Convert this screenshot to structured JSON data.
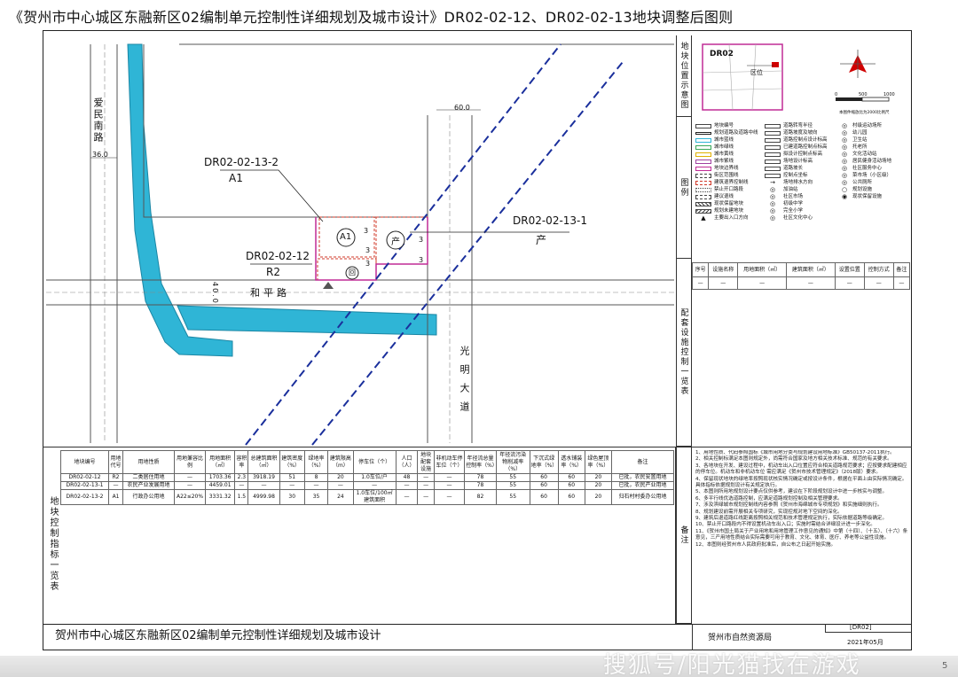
{
  "title": "《贺州市中心城区东融新区02编制单元控制性详细规划及城市设计》DR02-02-12、DR02-02-13地块调整后图则",
  "map": {
    "road_west_name": "爱民南路",
    "road_west_width": "36.0",
    "road_north_width": "60.0",
    "road_main_name": "和平路",
    "road_main_width": "40.0",
    "road_east_name": "光明大道",
    "parcel_a_code": "DR02-02-13-2",
    "parcel_a_use": "A1",
    "parcel_b_code": "DR02-02-12",
    "parcel_b_use": "R2",
    "parcel_c_code": "DR02-02-13-1",
    "parcel_c_use": "产",
    "circle_a1": "A1",
    "circle_chan": "产",
    "circle_wei": "回",
    "nums": [
      "3",
      "3",
      "3",
      "3",
      "3"
    ]
  },
  "location": {
    "header": "地块位置示意图",
    "unit_label": "DR02",
    "zone_label": "区位",
    "scale_ticks": [
      "0",
      "500",
      "1000"
    ],
    "scale_note": "本图件缩放比为2000比例尺"
  },
  "legend": {
    "header": "图例",
    "col1": [
      "地块编号",
      "规划道路及道路中线",
      "城市蓝线",
      "城市绿线",
      "城市黄线",
      "城市紫线",
      "地块边界线",
      "街区范围线",
      "建筑退界控制线",
      "禁止开口路段",
      "建议退线",
      "现状保留地块",
      "规划未建地块",
      "主要出入口方向"
    ],
    "col2": [
      "道路转弯半径",
      "道路坡度及坡向",
      "道路控制点设计标高",
      "已建道路控制点标高",
      "拟设计控制点标高",
      "场地设计标高",
      "道路坡长",
      "控制点坐标",
      "场地排水方向",
      "加油站",
      "社区市场",
      "初级中学",
      "完全小学",
      "社区文化中心"
    ],
    "col3": [
      "村级运动场所",
      "幼儿园",
      "卫生站",
      "托老所",
      "文化活动站",
      "居民健身活动场地",
      "社区服务中心",
      "菜市场（小区级）",
      "公共厕所",
      "规划设施",
      "现状保留设施"
    ]
  },
  "facility": {
    "header": "配套设施控制一览表",
    "columns": [
      "序号",
      "设施名称",
      "用地面积（㎡）",
      "建筑面积（㎡）",
      "设置位置",
      "控制方式",
      "备注"
    ],
    "row": [
      "—",
      "—",
      "—",
      "—",
      "—",
      "—",
      "—"
    ]
  },
  "indicator": {
    "header": "地块控制指标一览表",
    "columns": [
      "地块编号",
      "用地代号",
      "用地性质",
      "用地兼容比例",
      "用地面积（㎡）",
      "容积率",
      "总建筑面积（㎡）",
      "建筑密度（%）",
      "绿地率（%）",
      "建筑限高（m）",
      "停车位（个）",
      "配套设施",
      "人口（人）",
      "地块配套设施",
      "非机动车停车位（个）",
      "年径流总量控制率（%）",
      "年径流污染物削减率（%）",
      "下沉式绿地率（%）",
      "透水铺装率（%）",
      "绿色屋顶率（%）",
      "备注"
    ],
    "rows": [
      [
        "DR02-02-12",
        "R2",
        "二类居住用地",
        "—",
        "1703.36",
        "2.3",
        "3918.19",
        "51",
        "8",
        "20",
        "1.0车位/户",
        "48",
        "—",
        "—",
        "78",
        "55",
        "60",
        "60",
        "20",
        "已批，农民安置用地"
      ],
      [
        "DR02-02-13-1",
        "—",
        "农民产业发展用地",
        "—",
        "4459.01",
        "—",
        "—",
        "—",
        "—",
        "—",
        "—",
        "—",
        "—",
        "—",
        "78",
        "55",
        "60",
        "60",
        "20",
        "已批，农民产业用地"
      ],
      [
        "DR02-02-13-2",
        "A1",
        "行政办公用地",
        "A22≤20%",
        "3331.32",
        "1.5",
        "4999.98",
        "30",
        "35",
        "24",
        "1.0车位/100㎡建筑面积",
        "—",
        "—",
        "—",
        "82",
        "55",
        "60",
        "60",
        "20",
        "归石村村委办公用地"
      ]
    ]
  },
  "notes": {
    "header": "备注",
    "items": [
      "1、用地性质、代码参照国标《城市用地分类与规划建设用地标准》GB50137-2011执行。",
      "2、相关控制标满足本图则规定外，尚需符合国家及地方相关技术标准、规范的有关要求。",
      "3、各地块在开发、建设过程中，机动车出入口位置应符合相关道路规范要求；应按要求配建相应的停车位。机动车和非机动车位 需应满足《贺州市技术管理规定》（2018版）要求。",
      "4、保留现状地块的绿地率按照现状核实情况确定或按设计条件，根据在平面上由实际情况确定。具体指标依据规划设计有关规定执行。",
      "5、本图则所用地规划设计要点仅供参考，建议在下阶段规划设计中进一步核实与调整。",
      "6、多平行线优选道路控制，应满足道路规划控制及相关管理要求。",
      "7、涉及滨绿城市规划控制线内容参照《贺州市海绵城市专项规划》和实施细则执行。",
      "8、规划建设前需开展相关专项研究，实现控规对地下空间的深化。",
      "9、建筑后退道路红线距离按照相关规范和技术管理规定执行，实际依据道路等级确定。",
      "10、禁止开口路段内不得设置机动车出入口；实施时需结合详细设计进一步深化。",
      "11、《贺州市国土局关于产业用地和用地管理工作意见的通知》中第（十四）、（十五）、（十六）条意见，三产用地性质结合实际需要可用于教育、文化、体育、医疗、养老等公益性设施。",
      "12、本图则经贺州市人民政府批准后，自公布之日起开始实施。"
    ]
  },
  "footer": {
    "plan_name": "贺州市中心城区东融新区02编制单元控制性详细规划及城市设计",
    "code": "[DR02]",
    "authority": "贺州市自然资源局",
    "date": "2021年05月"
  },
  "watermark": "搜狐号/阳光猫找在游戏",
  "page_num": "5",
  "colors": {
    "water": "#2fb5d6",
    "road_line": "#555555",
    "dashed_route": "#1a2f9c",
    "parcel_boundary": "#c02c96",
    "parcel_dash": "#d0392a",
    "north_arrow": "#d00000"
  }
}
